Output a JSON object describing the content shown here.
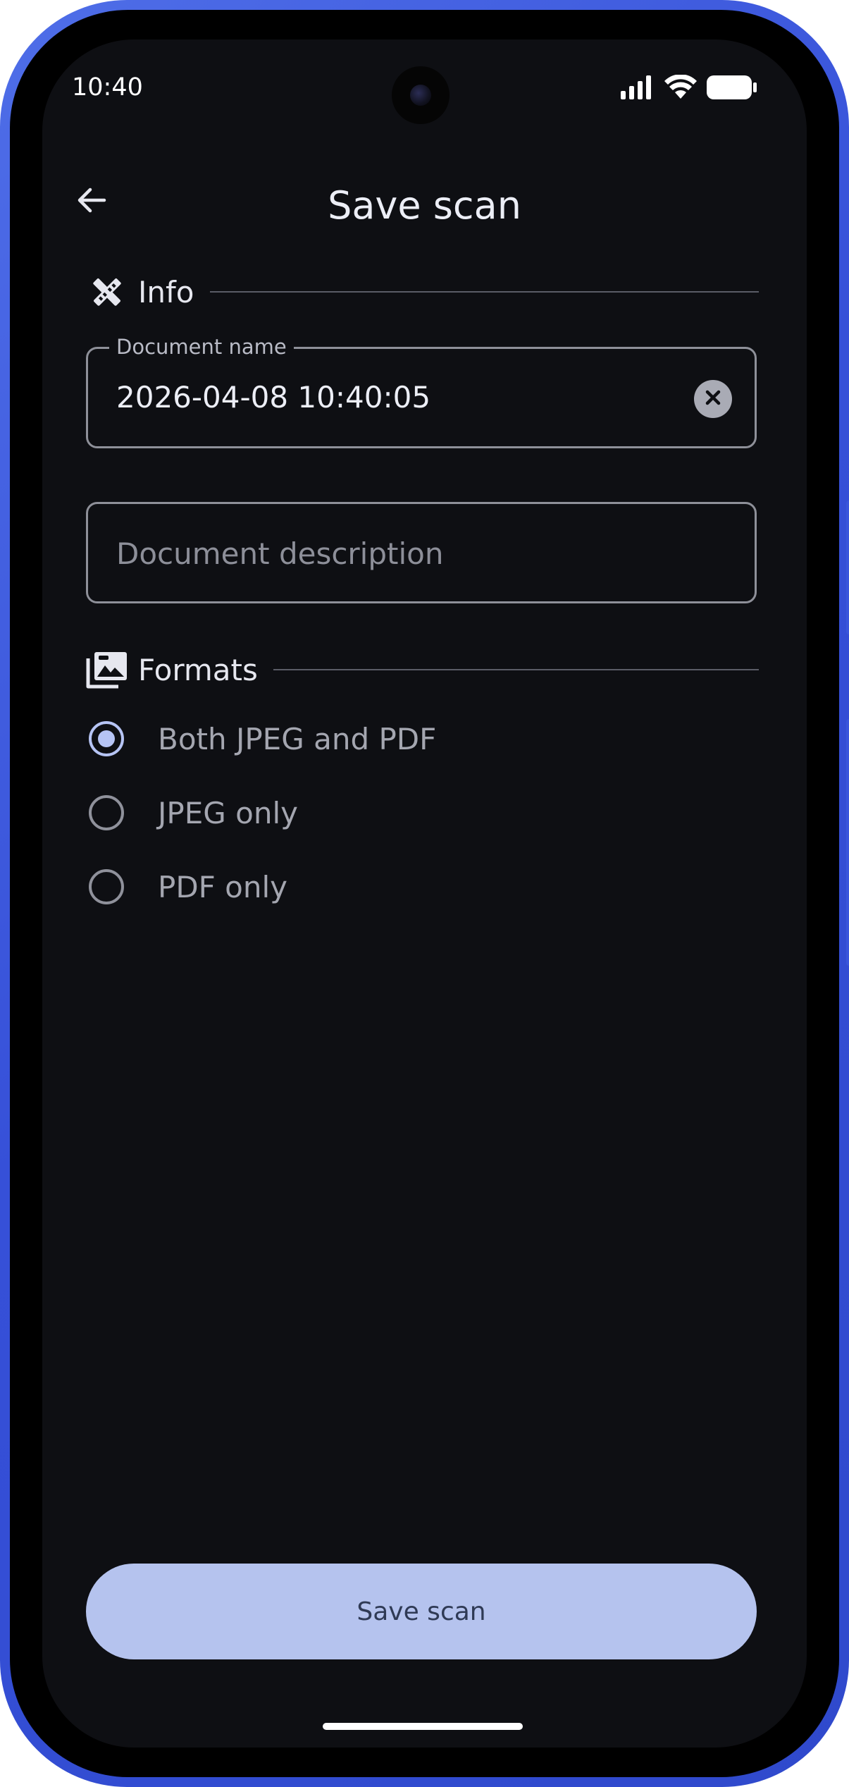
{
  "status_bar": {
    "time": "10:40",
    "icons": [
      "signal-icon",
      "wifi-icon",
      "battery-icon"
    ]
  },
  "header": {
    "title": "Save scan",
    "back_icon": "arrow-left-icon"
  },
  "info_section": {
    "label": "Info",
    "icon": "tools-icon",
    "name_field": {
      "label": "Document name",
      "value": "2026-04-08 10:40:05",
      "clear_icon": "clear-icon"
    },
    "description_field": {
      "placeholder": "Document description"
    }
  },
  "formats_section": {
    "label": "Formats",
    "icon": "photo-library-icon",
    "options": [
      {
        "label": "Both JPEG and PDF",
        "selected": true
      },
      {
        "label": "JPEG only",
        "selected": false
      },
      {
        "label": "PDF only",
        "selected": false
      }
    ]
  },
  "footer": {
    "save_label": "Save scan"
  },
  "colors": {
    "background": "#0e0f13",
    "accent": "#b6c4f4",
    "button": "#b5c3ee",
    "frame": "#3a56dc"
  }
}
